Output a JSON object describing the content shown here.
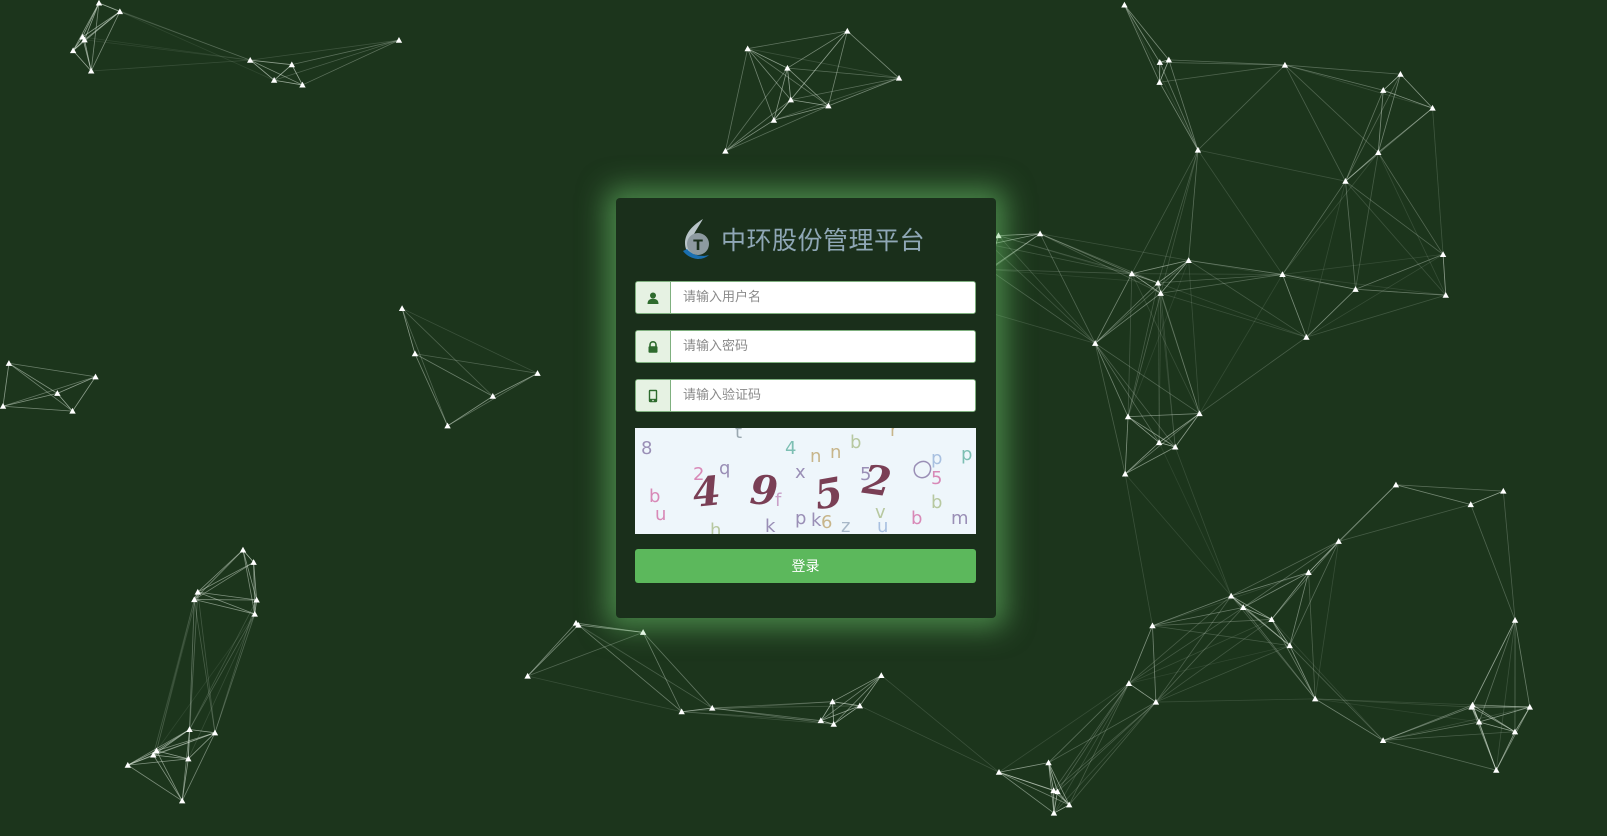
{
  "app": {
    "title": "中环股份管理平台"
  },
  "form": {
    "username_placeholder": "请输入用户名",
    "password_placeholder": "请输入密码",
    "captcha_placeholder": "请输入验证码",
    "login_label": "登录"
  },
  "captcha": {
    "main_digits": [
      "4",
      "9",
      "5",
      "2"
    ]
  },
  "icons": {
    "username": "user-icon",
    "password": "lock-icon",
    "captcha": "mobile-icon",
    "logo": "company-logo-icon"
  },
  "colors": {
    "background": "#1c351c",
    "panel": "#1a2f1b",
    "glow": "#6ec86e",
    "button": "#5cb85c",
    "title": "#8fa7b6",
    "captcha_digits": "#7a3f55"
  }
}
